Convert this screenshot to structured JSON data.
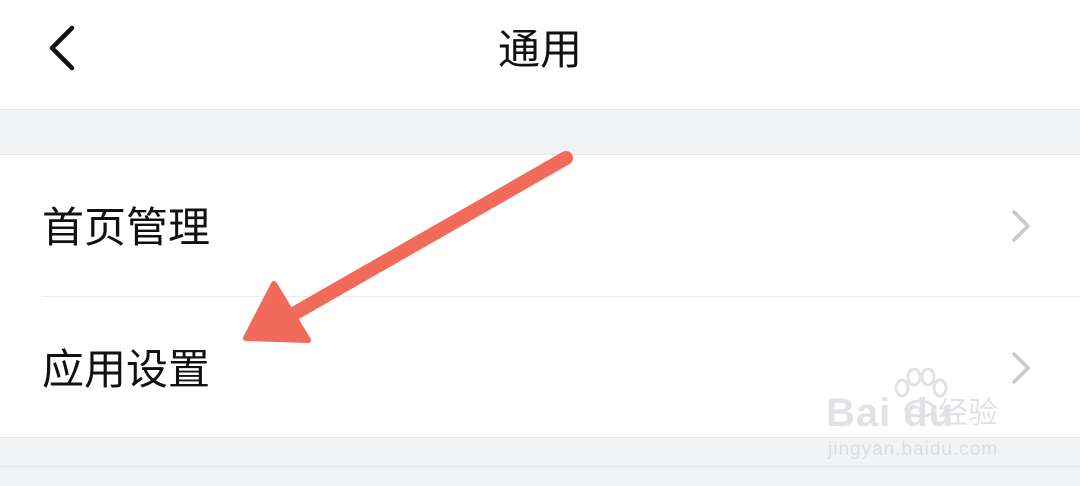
{
  "header": {
    "title": "通用",
    "back_icon": "chevron-left-icon"
  },
  "list": {
    "items": [
      {
        "label": "首页管理",
        "icon": "chevron-right-icon"
      },
      {
        "label": "应用设置",
        "icon": "chevron-right-icon"
      }
    ]
  },
  "annotation": {
    "arrow_color": "#f26a5a"
  },
  "watermark": {
    "brand": "Bai du",
    "sub": "经验",
    "url": "jingyan.baidu.com"
  },
  "colors": {
    "background": "#f2f3f5",
    "surface": "#ffffff",
    "text": "#111111",
    "chevron": "#c7c7cc"
  }
}
